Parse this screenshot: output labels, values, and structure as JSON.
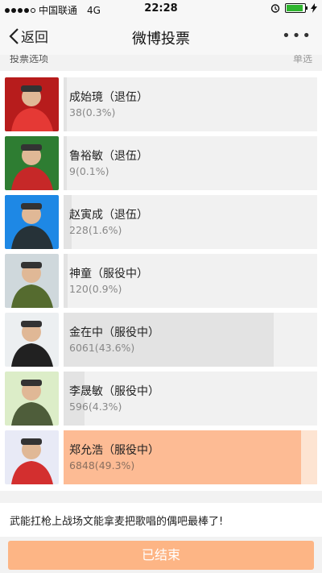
{
  "status": {
    "carrier": "中国联通",
    "network": "4G",
    "time": "22:28",
    "battery_color": "#2fb52f"
  },
  "nav": {
    "back_label": "返回",
    "title": "微博投票",
    "more_label": "•••"
  },
  "section": {
    "label": "投票选项",
    "mode": "单选"
  },
  "options": [
    {
      "name": "成始璄（退伍）",
      "count": "38(0.3%)",
      "percent": 0.3,
      "photo_bg": "#b71c1c",
      "photo_fg": "#e53935"
    },
    {
      "name": "鲁裕敏（退伍）",
      "count": "9(0.1%)",
      "percent": 0.1,
      "photo_bg": "#2e7d32",
      "photo_fg": "#c62828"
    },
    {
      "name": "赵寅成（退伍）",
      "count": "228(1.6%)",
      "percent": 1.6,
      "photo_bg": "#1e88e5",
      "photo_fg": "#263238"
    },
    {
      "name": "神童（服役中）",
      "count": "120(0.9%)",
      "percent": 0.9,
      "photo_bg": "#cfd8dc",
      "photo_fg": "#556b2f"
    },
    {
      "name": "金在中（服役中）",
      "count": "6061(43.6%)",
      "percent": 43.6,
      "photo_bg": "#eceff1",
      "photo_fg": "#212121"
    },
    {
      "name": "李晟敏（服役中）",
      "count": "596(4.3%)",
      "percent": 4.3,
      "photo_bg": "#dcedc8",
      "photo_fg": "#4e5d3a"
    },
    {
      "name": "郑允浩（服役中）",
      "count": "6848(49.3%)",
      "percent": 49.3,
      "photo_bg": "#e8eaf6",
      "photo_fg": "#d32f2f"
    }
  ],
  "comment": "武能扛枪上战场文能拿麦把歌唱的偶吧最棒了!",
  "footer": {
    "ended_label": "已结束",
    "accent": "#fdb585"
  }
}
